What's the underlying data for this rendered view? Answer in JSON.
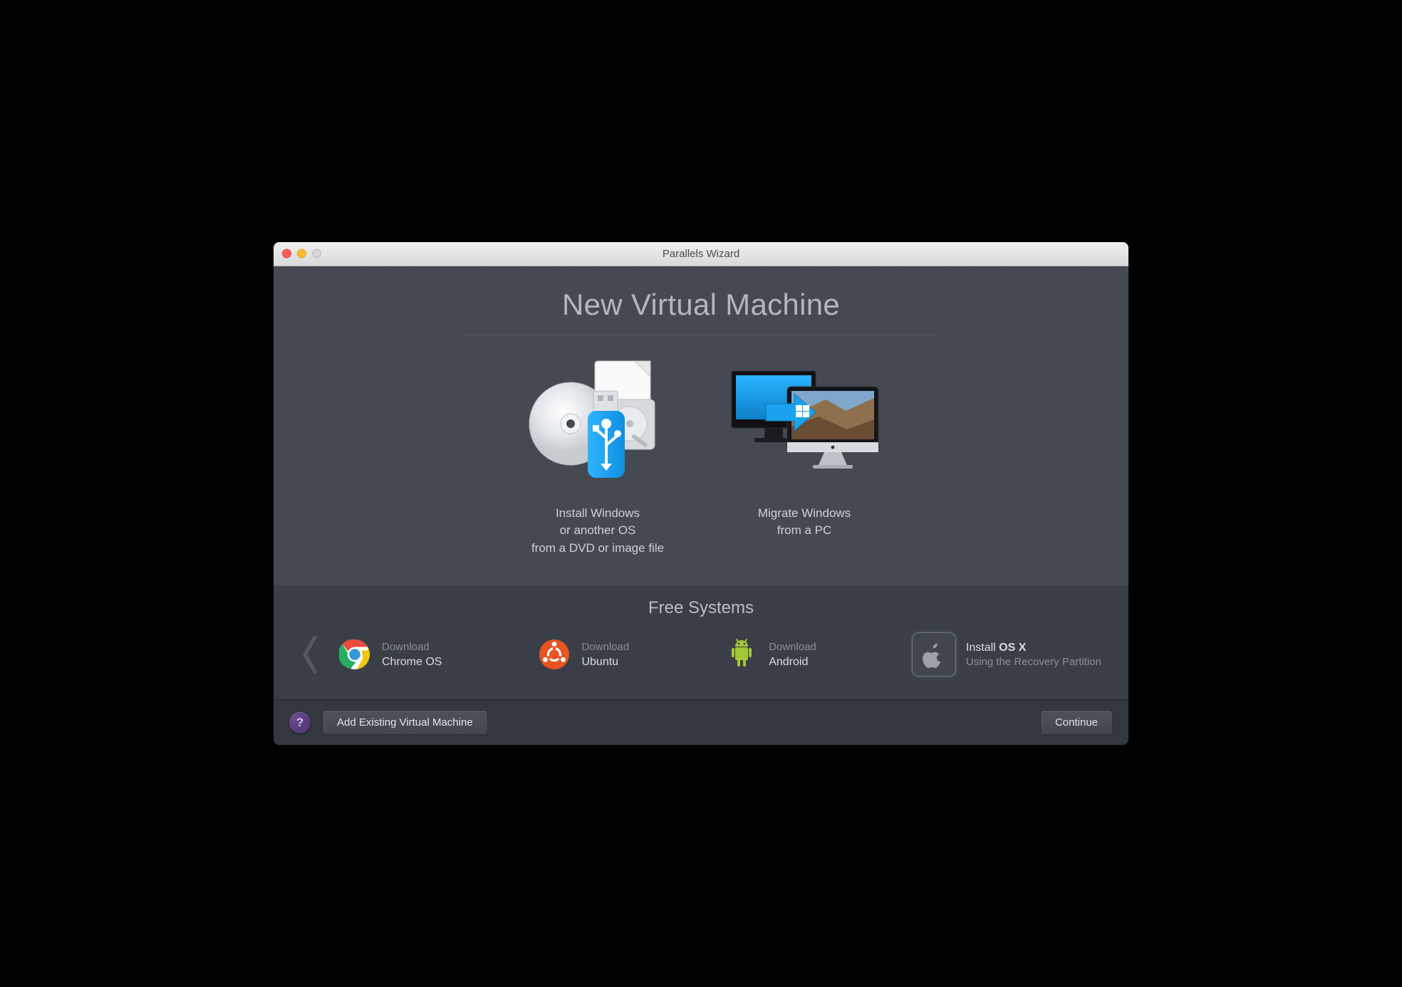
{
  "window": {
    "title": "Parallels Wizard"
  },
  "heading": "New Virtual Machine",
  "options": {
    "install": {
      "label_l1": "Install Windows",
      "label_l2": "or another OS",
      "label_l3": "from a DVD or image file",
      "icon": "dvd-usb-disk-icon"
    },
    "migrate": {
      "label_l1": "Migrate Windows",
      "label_l2": "from a PC",
      "icon": "migrate-pc-to-mac-icon"
    }
  },
  "free_systems": {
    "title": "Free Systems",
    "items": [
      {
        "icon": "chrome-icon",
        "line1": "Download",
        "line2": "Chrome OS",
        "selected": false
      },
      {
        "icon": "ubuntu-icon",
        "line1": "Download",
        "line2": "Ubuntu",
        "selected": false
      },
      {
        "icon": "android-icon",
        "line1": "Download",
        "line2": "Android",
        "selected": false
      },
      {
        "icon": "apple-icon",
        "line1_prefix": "Install ",
        "line1_strong": "OS X",
        "line2": "Using the Recovery Partition",
        "selected": true
      }
    ]
  },
  "footer": {
    "help_tooltip": "?",
    "add_existing": "Add Existing Virtual Machine",
    "continue": "Continue"
  },
  "colors": {
    "window_bg": "#444952",
    "section_bg": "#3a3f47",
    "footer_bg": "#33373e",
    "accent_purple": "#5a3e86"
  }
}
